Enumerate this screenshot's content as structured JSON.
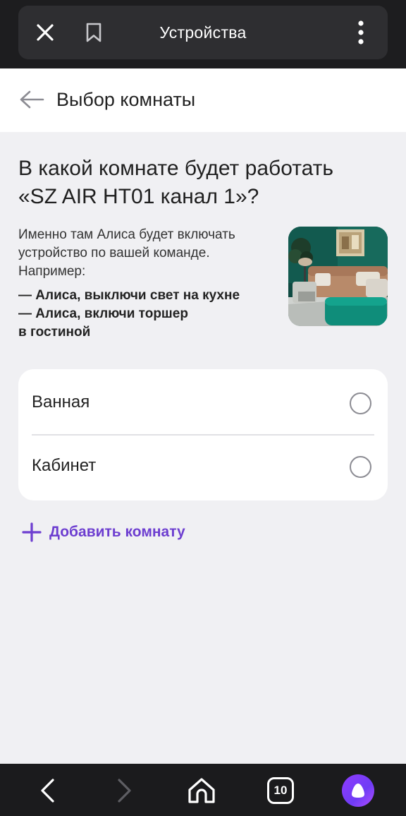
{
  "browser": {
    "title": "Устройства",
    "icons": {
      "close": "close-icon",
      "bookmark": "bookmark-icon",
      "menu": "more-vertical-icon"
    }
  },
  "header": {
    "title": "Выбор комнаты",
    "back_icon": "arrow-left-icon"
  },
  "question": {
    "line1": "В какой комнате будет работать",
    "line2": "«SZ AIR HT01 канал 1»?"
  },
  "description": "Именно там Алиса будет включать устройство по вашей команде. Например:",
  "examples": [
    "— Алиса, выключи свет на кухне",
    "— Алиса, включи торшер",
    "в гостиной"
  ],
  "rooms": [
    {
      "label": "Ванная",
      "selected": false
    },
    {
      "label": "Кабинет",
      "selected": false
    }
  ],
  "add_room": {
    "label": "Добавить комнату",
    "icon": "plus-icon"
  },
  "bottom_nav": {
    "tabs_count": "10",
    "icons": [
      "back-icon",
      "forward-icon",
      "home-icon",
      "tabs-icon",
      "alice-icon"
    ]
  },
  "colors": {
    "accent": "#6d3ed0",
    "background": "#f0f0f3",
    "topbar": "#1d1d1f"
  }
}
